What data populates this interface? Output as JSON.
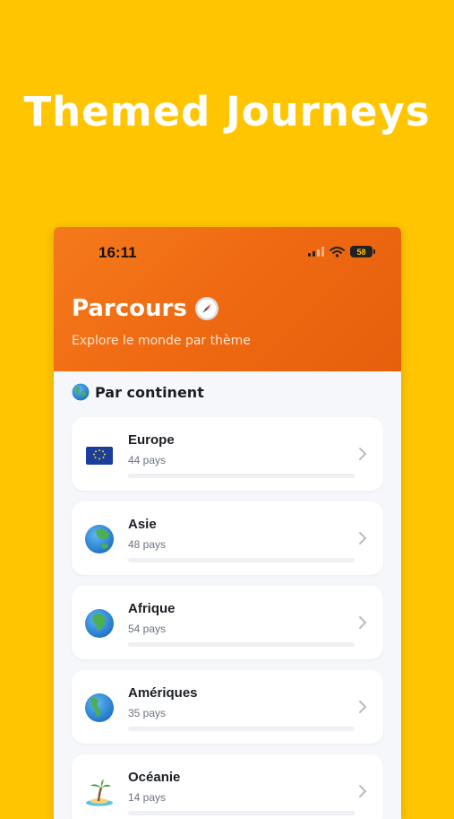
{
  "promo": {
    "headline": "Themed Journeys"
  },
  "status_bar": {
    "time": "16:11",
    "battery": "58"
  },
  "header": {
    "title": "Parcours",
    "title_icon": "compass-icon",
    "subtitle": "Explore le monde par thème",
    "gradient": [
      "#F57A1C",
      "#E65F0C"
    ]
  },
  "section": {
    "title": "Par continent",
    "icon": "globe-icon"
  },
  "continents": [
    {
      "name": "Europe",
      "count": "44 pays",
      "icon": "eu-flag-icon",
      "progress": 0
    },
    {
      "name": "Asie",
      "count": "48 pays",
      "icon": "globe-icon",
      "progress": 0
    },
    {
      "name": "Afrique",
      "count": "54 pays",
      "icon": "globe-icon",
      "progress": 0
    },
    {
      "name": "Amériques",
      "count": "35 pays",
      "icon": "globe-icon",
      "progress": 0
    },
    {
      "name": "Océanie",
      "count": "14 pays",
      "icon": "island-icon",
      "progress": 0
    }
  ],
  "colors": {
    "background": "#FFC500",
    "accent": "#F06A12",
    "card": "#FFFFFF"
  }
}
